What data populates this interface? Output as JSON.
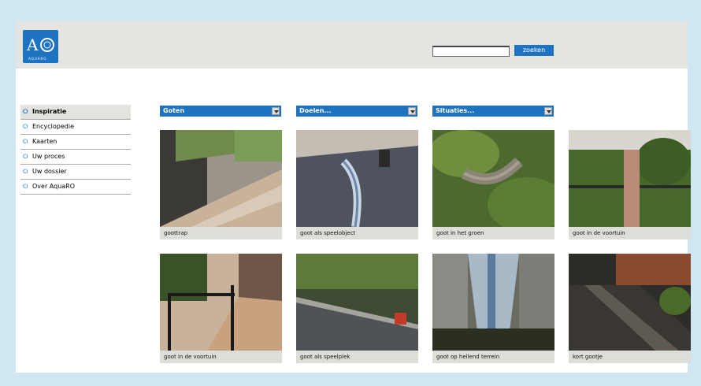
{
  "header": {
    "logo_text": "A",
    "logo_sub": "AQUARO"
  },
  "search": {
    "placeholder": "",
    "button_label": "zoeken"
  },
  "nav": {
    "items": [
      {
        "label": "Inspiratie",
        "active": true
      },
      {
        "label": "Encyclopedie",
        "active": false
      },
      {
        "label": "Kaarten",
        "active": false
      },
      {
        "label": "Uw proces",
        "active": false
      },
      {
        "label": "Uw dossier",
        "active": false
      },
      {
        "label": "Over AquaRO",
        "active": false
      }
    ]
  },
  "filters": [
    {
      "label": "Goten"
    },
    {
      "label": "Doelen..."
    },
    {
      "label": "Situaties..."
    }
  ],
  "gallery": {
    "items": [
      {
        "caption": "goottrap"
      },
      {
        "caption": "goot als speelobject"
      },
      {
        "caption": "goot in het groen"
      },
      {
        "caption": "goot in de voortuin"
      },
      {
        "caption": "goot in de voortuin"
      },
      {
        "caption": "goot als speelplek"
      },
      {
        "caption": "goot op hellend terrein"
      },
      {
        "caption": "kort gootje"
      }
    ]
  },
  "colors": {
    "accent": "#1e73c0",
    "page_bg": "#cfe6f3",
    "header_bg": "#e4e4e0"
  }
}
